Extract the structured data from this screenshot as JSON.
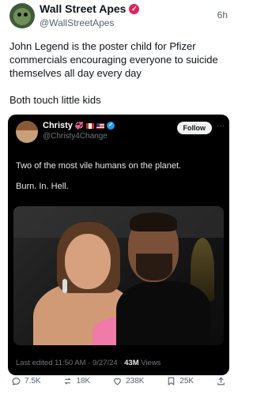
{
  "outer_post": {
    "display_name": "Wall Street Apes",
    "handle": "@WallStreetApes",
    "time": "6h",
    "text_paragraph_1": "John Legend is the poster child for Pfizer commercials encouraging everyone to suicide themselves all day every day",
    "text_paragraph_2": "Both touch little kids"
  },
  "quoted_post": {
    "display_name": "Christy",
    "handle": "@Christy4Change",
    "follow_label": "Follow",
    "text_paragraph_1": "Two of the most vile humans on the planet.",
    "text_paragraph_2": "Burn. In. Hell.",
    "edited_info": "Last edited 11:50 AM · 9/27/24 · ",
    "views_count": "43M",
    "views_label": " Views"
  },
  "actions": {
    "replies": "7.5K",
    "reposts": "18K",
    "likes": "238K",
    "bookmarks": "25K"
  },
  "colors": {
    "verified_pink": "#e0245e",
    "verified_blue": "#1d9bf0",
    "card_bg": "#000000"
  },
  "icons": [
    "verified-badge-icon",
    "heart-emoji-icon",
    "canada-flag-icon",
    "us-flag-icon",
    "more-icon",
    "reply-icon",
    "repost-icon",
    "like-icon",
    "bookmark-icon",
    "share-icon"
  ]
}
